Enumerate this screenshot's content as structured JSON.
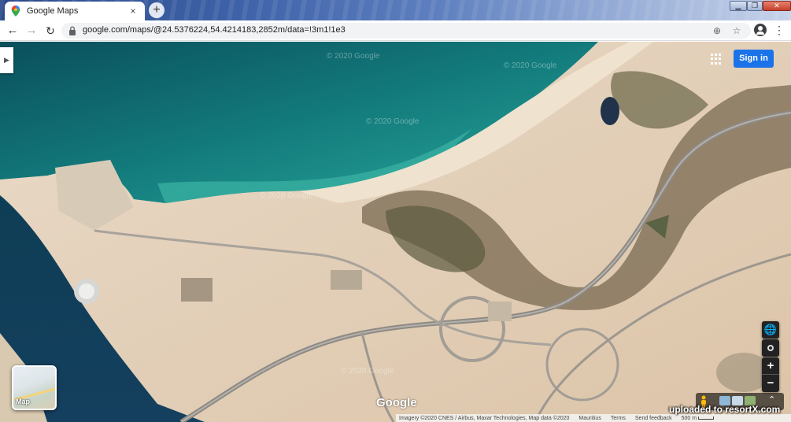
{
  "browser": {
    "tab": {
      "title": "Google Maps",
      "close_glyph": "×"
    },
    "new_tab_glyph": "+",
    "window_controls": {
      "minimize": "▁",
      "maximize": "❐",
      "close": "✕"
    },
    "nav": {
      "back": "←",
      "forward": "→",
      "reload": "↻"
    },
    "url": "google.com/maps/@24.5376224,54.4214183,2852m/data=!3m1!1e3",
    "omnibox_icons": {
      "zoom": "⊕",
      "star": "☆"
    },
    "menu_glyph": "⋮"
  },
  "map": {
    "watermark": "© 2020 Google",
    "side_panel_toggle": "▶",
    "sign_in_label": "Sign in",
    "globe_glyph": "🌐",
    "zoom_in": "+",
    "zoom_out": "−",
    "layer_thumbnail_label": "Map",
    "google_logo": "Google",
    "expand_glyph": "⌃",
    "footer": {
      "attribution": "Imagery ©2020 CNES / Airbus, Maxar Technologies, Map data ©2020",
      "country": "Mauritius",
      "terms": "Terms",
      "feedback": "Send feedback",
      "scale": "500 m"
    },
    "overlay_watermark": "uploaded to resortX.com"
  },
  "colors": {
    "sea_deep": "#0b4e5a",
    "sea_shallow": "#2a9d97",
    "sand": "#e6d4bf",
    "signin_blue": "#1a73e8"
  }
}
